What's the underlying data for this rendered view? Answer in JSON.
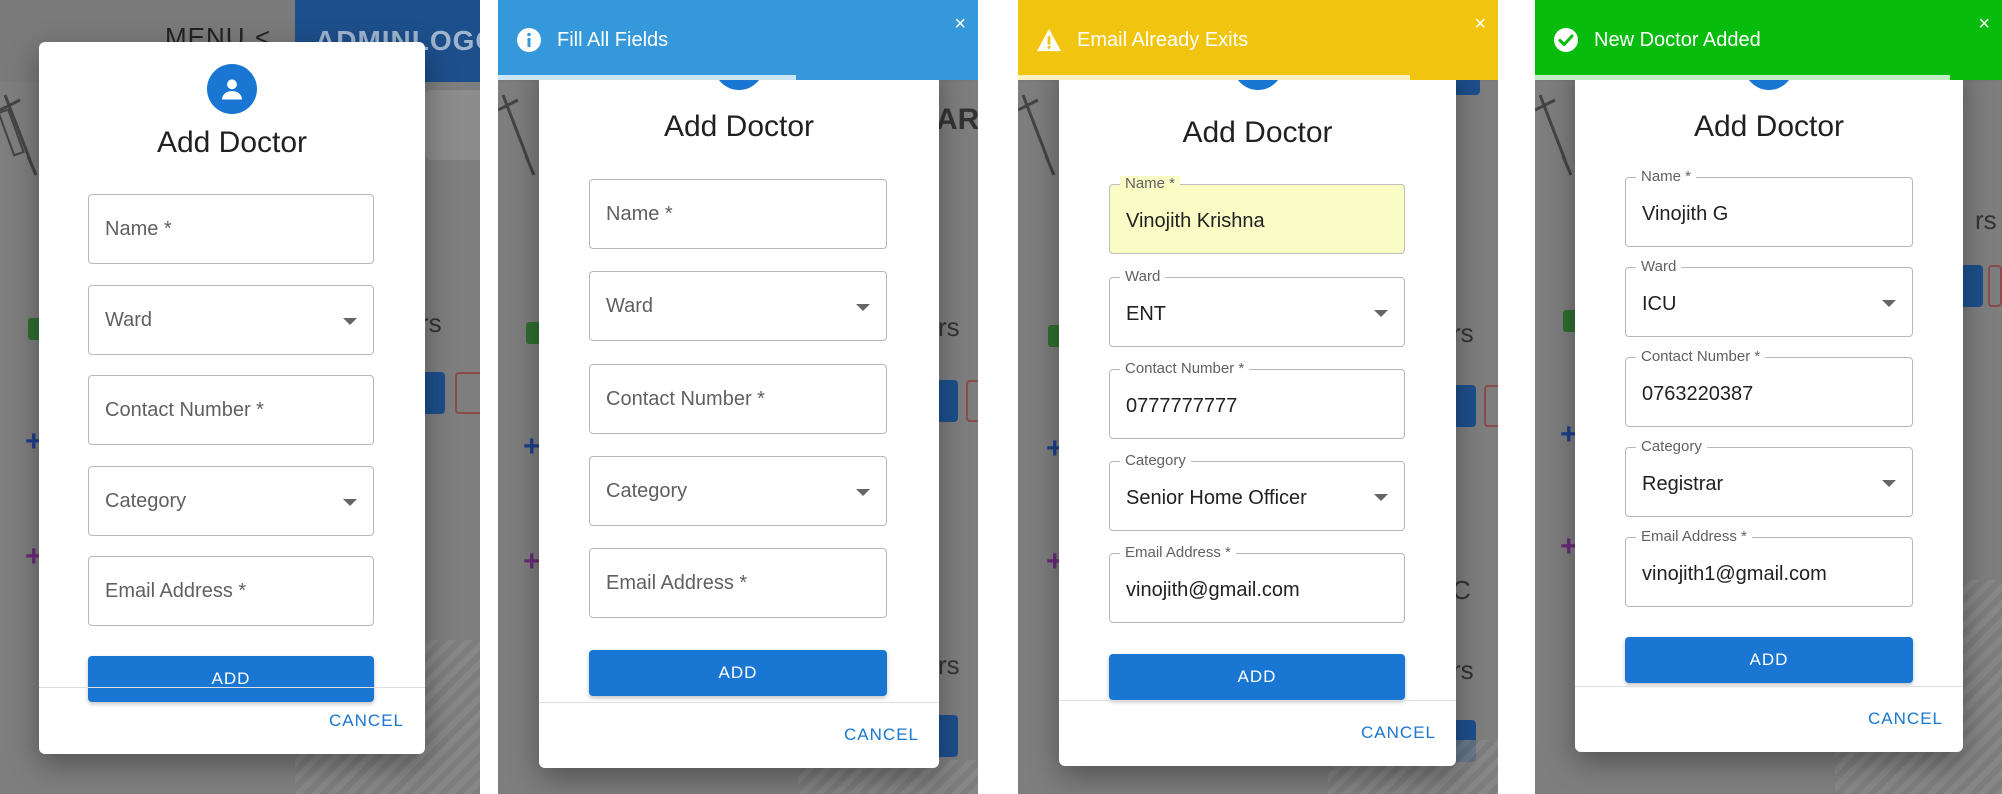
{
  "background": {
    "menu_label": "MENU",
    "menu_chevron": "<",
    "brand_text": "ADMINLOGO",
    "fragment_ar": "AR",
    "fragment_rs": "rs",
    "fragment_c": "C",
    "plus_sign": "+"
  },
  "dialog": {
    "title": "Add Doctor",
    "avatar_icon": "person-icon",
    "add_label": "ADD",
    "cancel_label": "CANCEL",
    "fields": {
      "name_placeholder": "Name *",
      "ward_placeholder": "Ward",
      "contact_placeholder": "Contact Number *",
      "category_placeholder": "Category",
      "email_placeholder": "Email Address *",
      "name_label": "Name *",
      "ward_label": "Ward",
      "contact_label": "Contact Number *",
      "category_label": "Category",
      "email_label": "Email Address *"
    }
  },
  "panels": [
    {
      "state": "empty",
      "toast": null
    },
    {
      "state": "empty",
      "toast": {
        "type": "info",
        "icon": "info-icon",
        "message": "Fill All Fields",
        "close": "×",
        "color": "#3498db"
      }
    },
    {
      "state": "filled",
      "toast": {
        "type": "warning",
        "icon": "warning-icon",
        "message": "Email Already Exits",
        "close": "×",
        "color": "#f1c40f"
      },
      "values": {
        "name": "Vinojith Krishna",
        "ward": "ENT",
        "contact": "0777777777",
        "category": "Senior Home Officer",
        "email": "vinojith@gmail.com"
      }
    },
    {
      "state": "filled",
      "toast": {
        "type": "success",
        "icon": "check-circle-icon",
        "message": "New Doctor Added",
        "close": "×",
        "color": "#07bc0c"
      },
      "values": {
        "name": "Vinojith G",
        "ward": "ICU",
        "contact": "0763220387",
        "category": "Registrar",
        "email": "vinojith1@gmail.com"
      }
    }
  ],
  "colors": {
    "primary": "#1976d2",
    "info": "#3498db",
    "warning": "#f1c40f",
    "success": "#07bc0c",
    "autofill": "#fafcc6"
  }
}
